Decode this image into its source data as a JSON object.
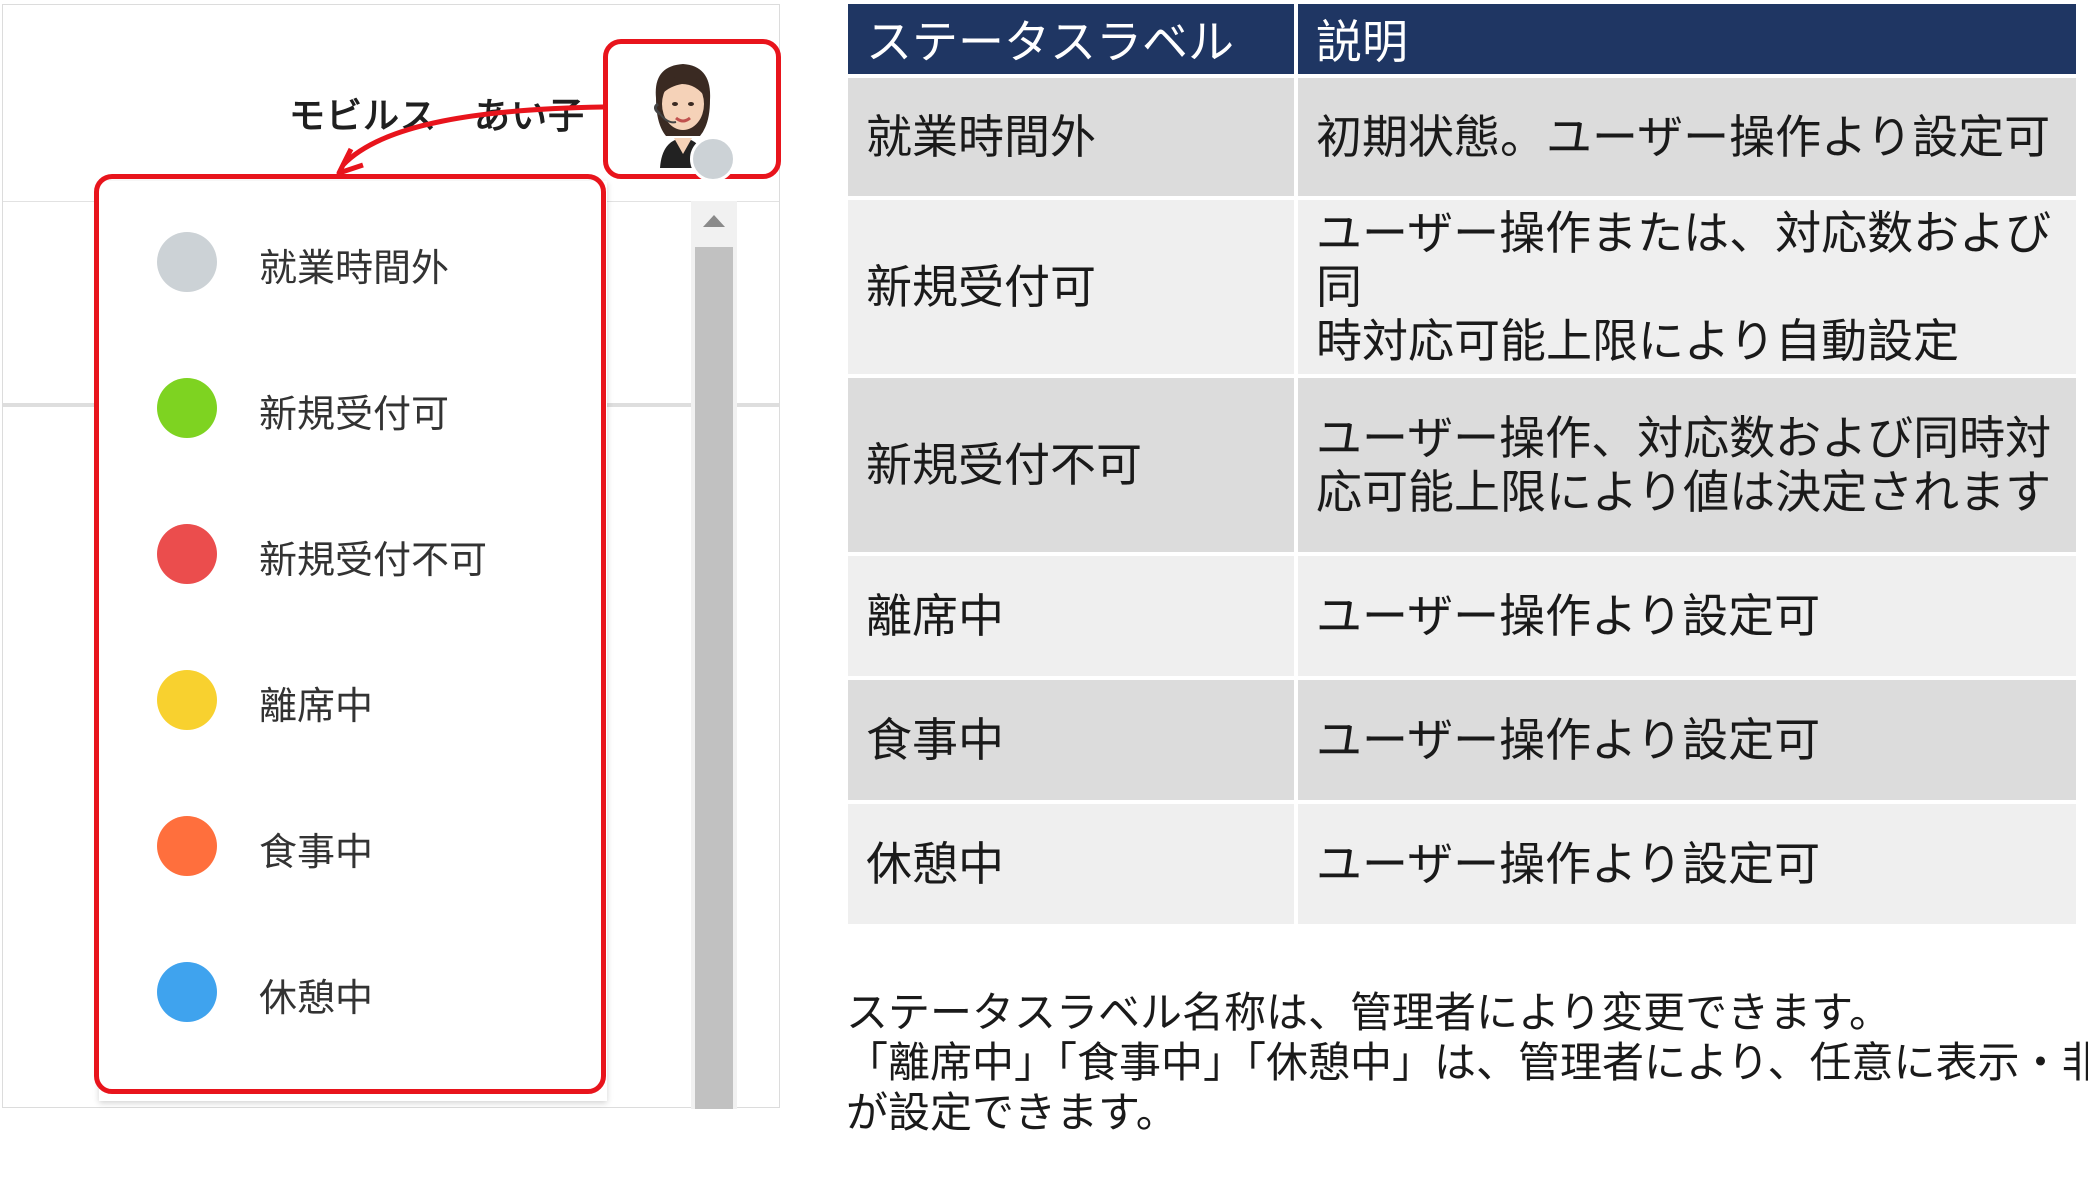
{
  "header": {
    "user_name": "モビルス　あい子",
    "avatar_status_color": "#ccd2d6"
  },
  "status_menu": {
    "items": [
      {
        "label": "就業時間外",
        "color": "#ccd2d6"
      },
      {
        "label": "新規受付可",
        "color": "#7ed321"
      },
      {
        "label": "新規受付不可",
        "color": "#eb4d4d"
      },
      {
        "label": "離席中",
        "color": "#f8d12f"
      },
      {
        "label": "食事中",
        "color": "#ff6f3d"
      },
      {
        "label": "休憩中",
        "color": "#3fa3ee"
      }
    ]
  },
  "status_table": {
    "headers": [
      "ステータスラベル",
      "説明"
    ],
    "rows": [
      {
        "label": "就業時間外",
        "desc": [
          "初期状態。ユーザー操作より設定可"
        ]
      },
      {
        "label": "新規受付可",
        "desc": [
          "ユーザー操作または、対応数および同",
          "時対応可能上限により自動設定"
        ]
      },
      {
        "label": "新規受付不可",
        "desc": [
          "ユーザー操作、対応数および同時対",
          "応可能上限により値は決定されます"
        ]
      },
      {
        "label": "離席中",
        "desc": [
          "ユーザー操作より設定可"
        ]
      },
      {
        "label": "食事中",
        "desc": [
          "ユーザー操作より設定可"
        ]
      },
      {
        "label": "休憩中",
        "desc": [
          "ユーザー操作より設定可"
        ]
      }
    ]
  },
  "notes": [
    "ステータスラベル名称は、管理者により変更できます。",
    "「離席中」「食事中」「休憩中」は、管理者により、任意に表示・非表示",
    "が設定できます。"
  ],
  "colors": {
    "highlight": "#e8141c",
    "table_header": "#1f3663"
  }
}
